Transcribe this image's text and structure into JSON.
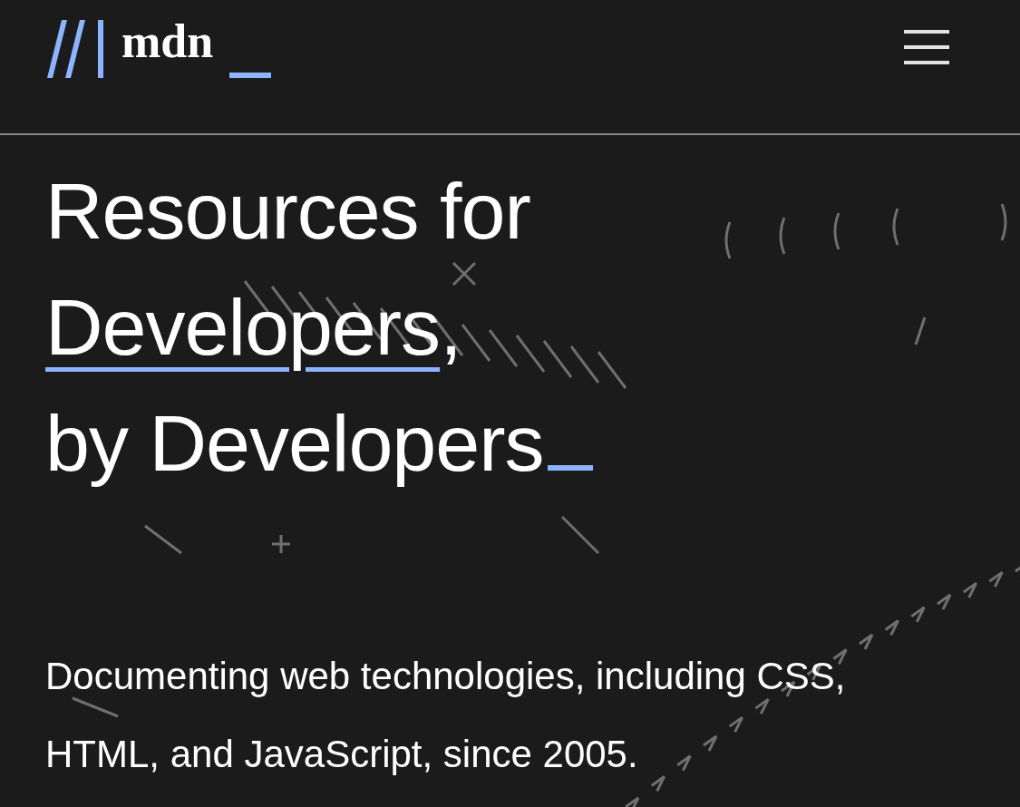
{
  "header": {
    "logo_text": "mdn"
  },
  "hero": {
    "line_1": "Resources for",
    "link": "Developers",
    "after_link": ",",
    "line_3": "by Developers",
    "description": "Documenting web technologies, including CSS, HTML, and JavaScript, since 2005."
  }
}
